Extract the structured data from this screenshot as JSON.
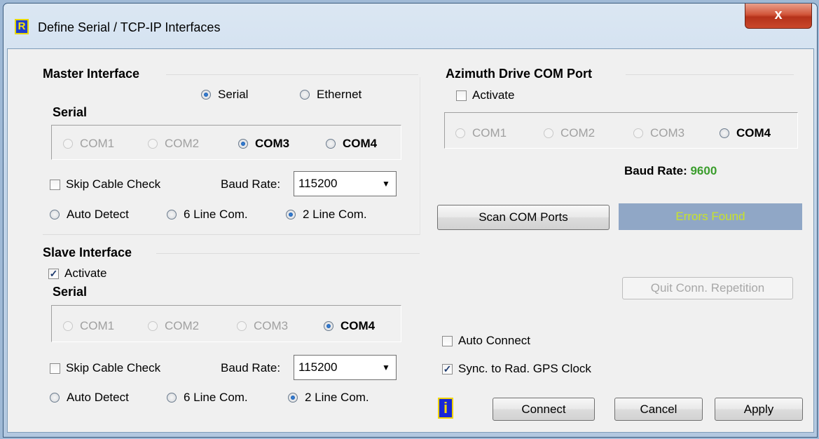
{
  "window": {
    "title": "Define Serial / TCP-IP Interfaces",
    "close_label": "x",
    "app_icon_label": "R"
  },
  "master": {
    "title": "Master Interface",
    "mode_serial": "Serial",
    "mode_ethernet": "Ethernet",
    "selected_mode": "Serial",
    "serial_label": "Serial",
    "ports": [
      "COM1",
      "COM2",
      "COM3",
      "COM4"
    ],
    "selected_port": "COM3",
    "skip_cable_check": "Skip Cable Check",
    "baud_label": "Baud Rate:",
    "baud_value": "115200",
    "auto_detect": "Auto Detect",
    "six_line": "6 Line Com.",
    "two_line": "2 Line Com.",
    "selected_line": "2 Line Com."
  },
  "slave": {
    "title": "Slave Interface",
    "activate": "Activate",
    "activate_checked": true,
    "serial_label": "Serial",
    "ports": [
      "COM1",
      "COM2",
      "COM3",
      "COM4"
    ],
    "selected_port": "COM4",
    "skip_cable_check": "Skip Cable Check",
    "baud_label": "Baud Rate:",
    "baud_value": "115200",
    "auto_detect": "Auto Detect",
    "six_line": "6 Line Com.",
    "two_line": "2 Line Com.",
    "selected_line": "2 Line Com."
  },
  "azimuth": {
    "title": "Azimuth Drive COM Port",
    "activate": "Activate",
    "activate_checked": false,
    "ports": [
      "COM1",
      "COM2",
      "COM3",
      "COM4"
    ],
    "selected_port": "COM4",
    "baud_label": "Baud Rate:",
    "baud_value": "9600"
  },
  "scan_button": "Scan COM Ports",
  "status_text": "Errors Found",
  "quit_repetition": "Quit Conn. Repetition",
  "auto_connect": "Auto Connect",
  "sync_gps": "Sync. to Rad. GPS Clock",
  "sync_gps_checked": true,
  "info_icon_label": "i",
  "buttons": {
    "connect": "Connect",
    "cancel": "Cancel",
    "apply": "Apply"
  },
  "colors": {
    "status_bg": "#90a7c6",
    "status_text": "#c8e22b",
    "baud_value": "#3a9d2c"
  }
}
